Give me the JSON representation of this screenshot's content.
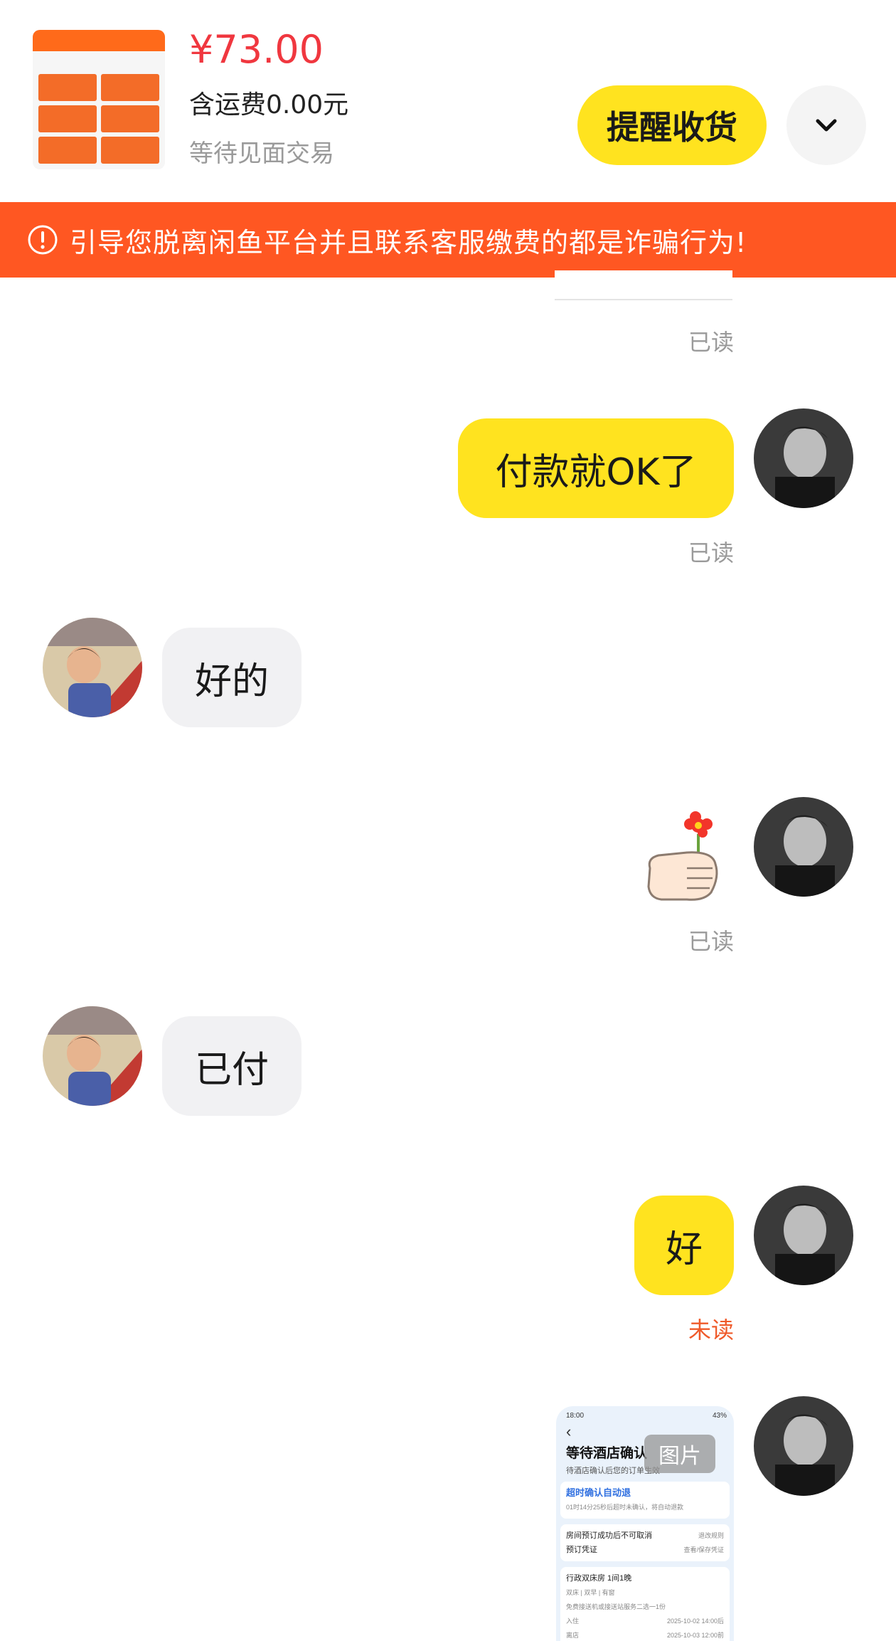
{
  "order": {
    "price": "¥73.00",
    "shipping": "含运费0.00元",
    "status": "等待见面交易",
    "remind_button": "提醒收货"
  },
  "warning": {
    "text": "引导您脱离闲鱼平台并且联系客服缴费的都是诈骗行为!"
  },
  "messages": [
    {
      "sender": "me",
      "status": "已读"
    },
    {
      "sender": "me",
      "text": "付款就OK了",
      "status": "已读"
    },
    {
      "sender": "other",
      "text": "好的"
    },
    {
      "sender": "me",
      "sticker": "thumbs-up-flower-sticker",
      "status": "已读"
    },
    {
      "sender": "other",
      "text": "已付"
    },
    {
      "sender": "me",
      "text": "好",
      "status": "未读"
    },
    {
      "sender": "me",
      "image_badge": "图片"
    }
  ],
  "screenshot_preview": {
    "status_time": "18:00",
    "status_battery": "43%",
    "title": "等待酒店确认",
    "subtitle": "待酒店确认后您的订单生效",
    "auto_cancel_title": "超时确认自动退",
    "auto_cancel_desc": "01时14分25秒后超时未确认，将自动退款",
    "rows": [
      {
        "label": "房间预订成功后不可取消",
        "value": "退改规则"
      },
      {
        "label": "预订凭证",
        "value": "查看/保存凭证"
      }
    ],
    "room_title": "行政双床房 1间1晚",
    "room_tags": "双床 | 双早 | 有窗",
    "room_service": "免费接送机或接送站服务二选一1份",
    "checkin_label": "入住",
    "checkin_value": "2025-10-02 14:00后",
    "checkout_label": "离店",
    "checkout_value": "2025-10-03 12:00前"
  },
  "colors": {
    "accent_yellow": "#ffe31f",
    "price_red": "#f0373f",
    "warning_orange": "#ff5722",
    "unread_orange": "#ef5a2a",
    "read_gray": "#9a9a9a"
  }
}
